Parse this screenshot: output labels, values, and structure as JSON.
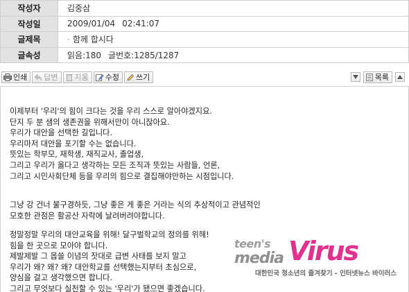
{
  "meta": {
    "author_label": "작성자",
    "author": "김중삼",
    "date_label": "작성일",
    "date": "2009/01/04",
    "time": "02:41:07",
    "subject_label": "글제목",
    "subject": "함께 합시다",
    "info_label": "글속성",
    "views": "읽음:180",
    "post_no": "글번호:1285/1287"
  },
  "toolbar": {
    "print": "인쇄",
    "reply": "답변",
    "delete": "지움",
    "edit": "수정",
    "write": "쓰기",
    "list": "목록"
  },
  "body": {
    "p1": [
      "이제부터 '우리'의 힘이 크다는 것을 우리 스스로 알아야겠지요.",
      "단지 두 분 샘의 생존권을 위해서만이 아니잖아요.",
      "우리가 대안을 선택한 길입니다.",
      "우리마저 대안을 포기할 수는 없습니다.",
      "뜻있는 학부모, 재학생, 재직교사, 졸업생,",
      "그리고 우리가 옳다고 생각하는 모든 조직과 뜻있는 사람들, 언론,",
      "그리고 시민사회단체 등을 우리의 힘으로 결집해야만하는 시점입니다."
    ],
    "p2": [
      "그냥 강 건너 불구경하듯, 그냥 좋은 게 좋은 거라는 식의 추상적이고 관념적인",
      "모호한 관점은 활공산 자락에 날려버려야합니다."
    ],
    "p3": [
      "정말정말 우리의 대안교육을 위해! 달구벌학교의 정의를 위해!",
      "힘을 한 곳으로 모아야 합니다.",
      "제발제발 그 몹쓸 이념의 잣대로 급변 사태를 보지 말고",
      "우리가 왜? 왜? 왜? 대안학교를 선택했는지부터 초심으로,",
      "양심을 걸고 생각했으면 합니다.",
      "그리고 무엇보다 실천할 수 있는 '우리'가 됐으면 좋겠습니다."
    ]
  },
  "watermark": {
    "teen": "teen's",
    "media": "media",
    "virus": "Virus",
    "tagline": "대한민국 청소년의 즐겨찾기 - 인터넷뉴스 바이러스",
    "brand_color": "#e0338d"
  }
}
